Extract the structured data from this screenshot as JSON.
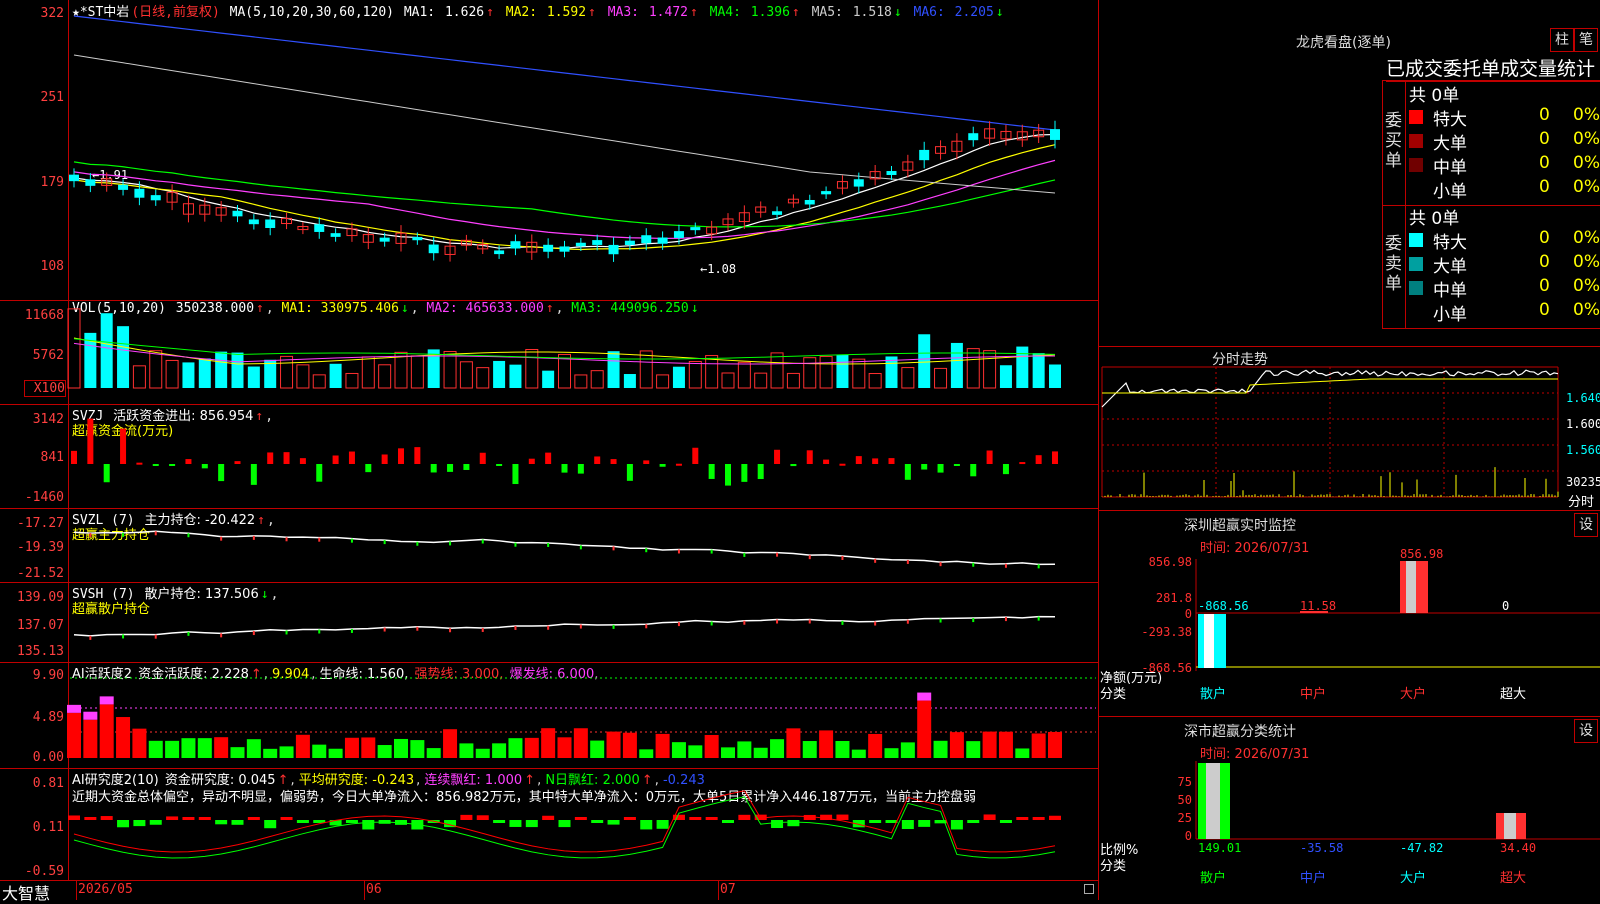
{
  "main": {
    "title": "★*ST中岩",
    "period": "(日线,前复权)",
    "ma_label": "MA(5,10,20,30,60,120)",
    "ma": [
      {
        "name": "MA1:",
        "value": "1.626",
        "arrow": "↑",
        "color": "#ffffff"
      },
      {
        "name": "MA2:",
        "value": "1.592",
        "arrow": "↑",
        "color": "#ffff00"
      },
      {
        "name": "MA3:",
        "value": "1.472",
        "arrow": "↑",
        "color": "#ff40ff"
      },
      {
        "name": "MA4:",
        "value": "1.396",
        "arrow": "↑",
        "color": "#00ff00"
      },
      {
        "name": "MA5:",
        "value": "1.518",
        "arrow": "↓",
        "color": "#cccccc"
      },
      {
        "name": "MA6:",
        "value": "2.205",
        "arrow": "↓",
        "color": "#3050ff"
      }
    ],
    "y_ticks": [
      "322",
      "251",
      "179",
      "108"
    ],
    "annot_high": "←1.91",
    "annot_low": "←1.08"
  },
  "vol": {
    "label": "VOL(5,10,20)",
    "value": "350238.000",
    "ma1": "MA1: 330975.406",
    "ma2": "MA2: 465633.000",
    "ma3": "MA3: 449096.250",
    "y_ticks": [
      "11668",
      "5762"
    ],
    "unit": "X100"
  },
  "svzj": {
    "label": "SVZJ",
    "text": "活跃资金进出: 856.954",
    "sub": "超赢资金流(万元)",
    "y_ticks": [
      "3142",
      "841",
      "-1460"
    ]
  },
  "svzl": {
    "label": "SVZL (7)",
    "text": "主力持仓: -20.422",
    "sub": "超赢主力持仓",
    "y_ticks": [
      "-17.27",
      "-19.39",
      "-21.52"
    ]
  },
  "svsh": {
    "label": "SVSH (7)",
    "text": "散户持仓: 137.506",
    "sub": "超赢散户持仓",
    "y_ticks": [
      "139.09",
      "137.07",
      "135.13"
    ]
  },
  "ai1": {
    "label": "AI活跃度2",
    "text": "资金活跃度: 2.228",
    "v2": "9.904",
    "life": "生命线: 1.560,",
    "strong": "强势线: 3.000,",
    "burst": "爆发线: 6.000,",
    "y_ticks": [
      "9.90",
      "4.89",
      "0.00"
    ]
  },
  "ai2": {
    "label": "AI研究度2(10)",
    "text": "资金研究度: 0.045",
    "avg": "平均研究度: -0.243",
    "cont": "连续飘红: 1.000",
    "nday": "N日飘红: 2.000",
    "last": "-0.243",
    "summary": "近期大资金总体偏空，异动不明显，偏弱势，今日大单净流入：856.982万元，其中特大单净流入：0万元，大单5日累计净入446.187万元，当前主力控盘弱",
    "y_ticks": [
      "0.81",
      "0.11",
      "-0.59"
    ]
  },
  "xaxis": {
    "brand": "大智慧",
    "labels": [
      "2026/05",
      "06",
      "07"
    ]
  },
  "right": {
    "lhb_title": "龙虎看盘(逐单)",
    "btn_zhu": "柱",
    "btn_bi": "笔",
    "stat_title": "已成交委托单成交量统计",
    "buy_label": "委买单",
    "sell_label": "委卖单",
    "buy_total": "共 0单",
    "sell_total": "共 0单",
    "buy_rows": [
      {
        "name": "特大",
        "count": "0",
        "pct": "0%",
        "color": "#ff0000"
      },
      {
        "name": "大单",
        "count": "0",
        "pct": "0%",
        "color": "#a00000"
      },
      {
        "name": "中单",
        "count": "0",
        "pct": "0%",
        "color": "#700000"
      },
      {
        "name": "小单",
        "count": "0",
        "pct": "0%",
        "color": ""
      }
    ],
    "sell_rows": [
      {
        "name": "特大",
        "count": "0",
        "pct": "0%",
        "color": "#00ffff"
      },
      {
        "name": "大单",
        "count": "0",
        "pct": "0%",
        "color": "#00a0a0"
      },
      {
        "name": "中单",
        "count": "0",
        "pct": "0%",
        "color": "#008080"
      },
      {
        "name": "小单",
        "count": "0",
        "pct": "0%",
        "color": ""
      }
    ],
    "fs_title": "分时走势",
    "fs_ticks": [
      "1.640",
      "1.600",
      "1.560",
      "30235"
    ],
    "fs_unit": "分时",
    "mon_title": "深圳超赢实时监控",
    "mon_time": "时间: 2026/07/31",
    "mon_ticks": [
      "856.98",
      "281.8",
      "0",
      "-293.38",
      "-868.56"
    ],
    "mon_net": "净额(万元)",
    "mon_cat": "分类",
    "mon_vals": [
      "-868.56",
      "11.58",
      "856.98",
      "0"
    ],
    "mon_cats": [
      "散户",
      "中户",
      "大户",
      "超大"
    ],
    "set": "设",
    "cls_title": "深市超赢分类统计",
    "cls_time": "时间: 2026/07/31",
    "cls_ticks": [
      "75",
      "50",
      "25",
      "0"
    ],
    "cls_ratio": "比例%",
    "cls_cat": "分类",
    "cls_vals": [
      "149.01",
      "-35.58",
      "-47.82",
      "34.40"
    ],
    "cls_cats": [
      "散户",
      "中户",
      "大户",
      "超大"
    ]
  },
  "colors": {
    "up": "#ff3030",
    "down": "#00ffff",
    "border": "#c00000",
    "ma_white": "#ffffff",
    "ma_yellow": "#ffff00",
    "ma_magenta": "#ff40ff",
    "ma_green": "#00ff00",
    "ma_gray": "#cccccc",
    "ma_blue": "#3050ff"
  }
}
